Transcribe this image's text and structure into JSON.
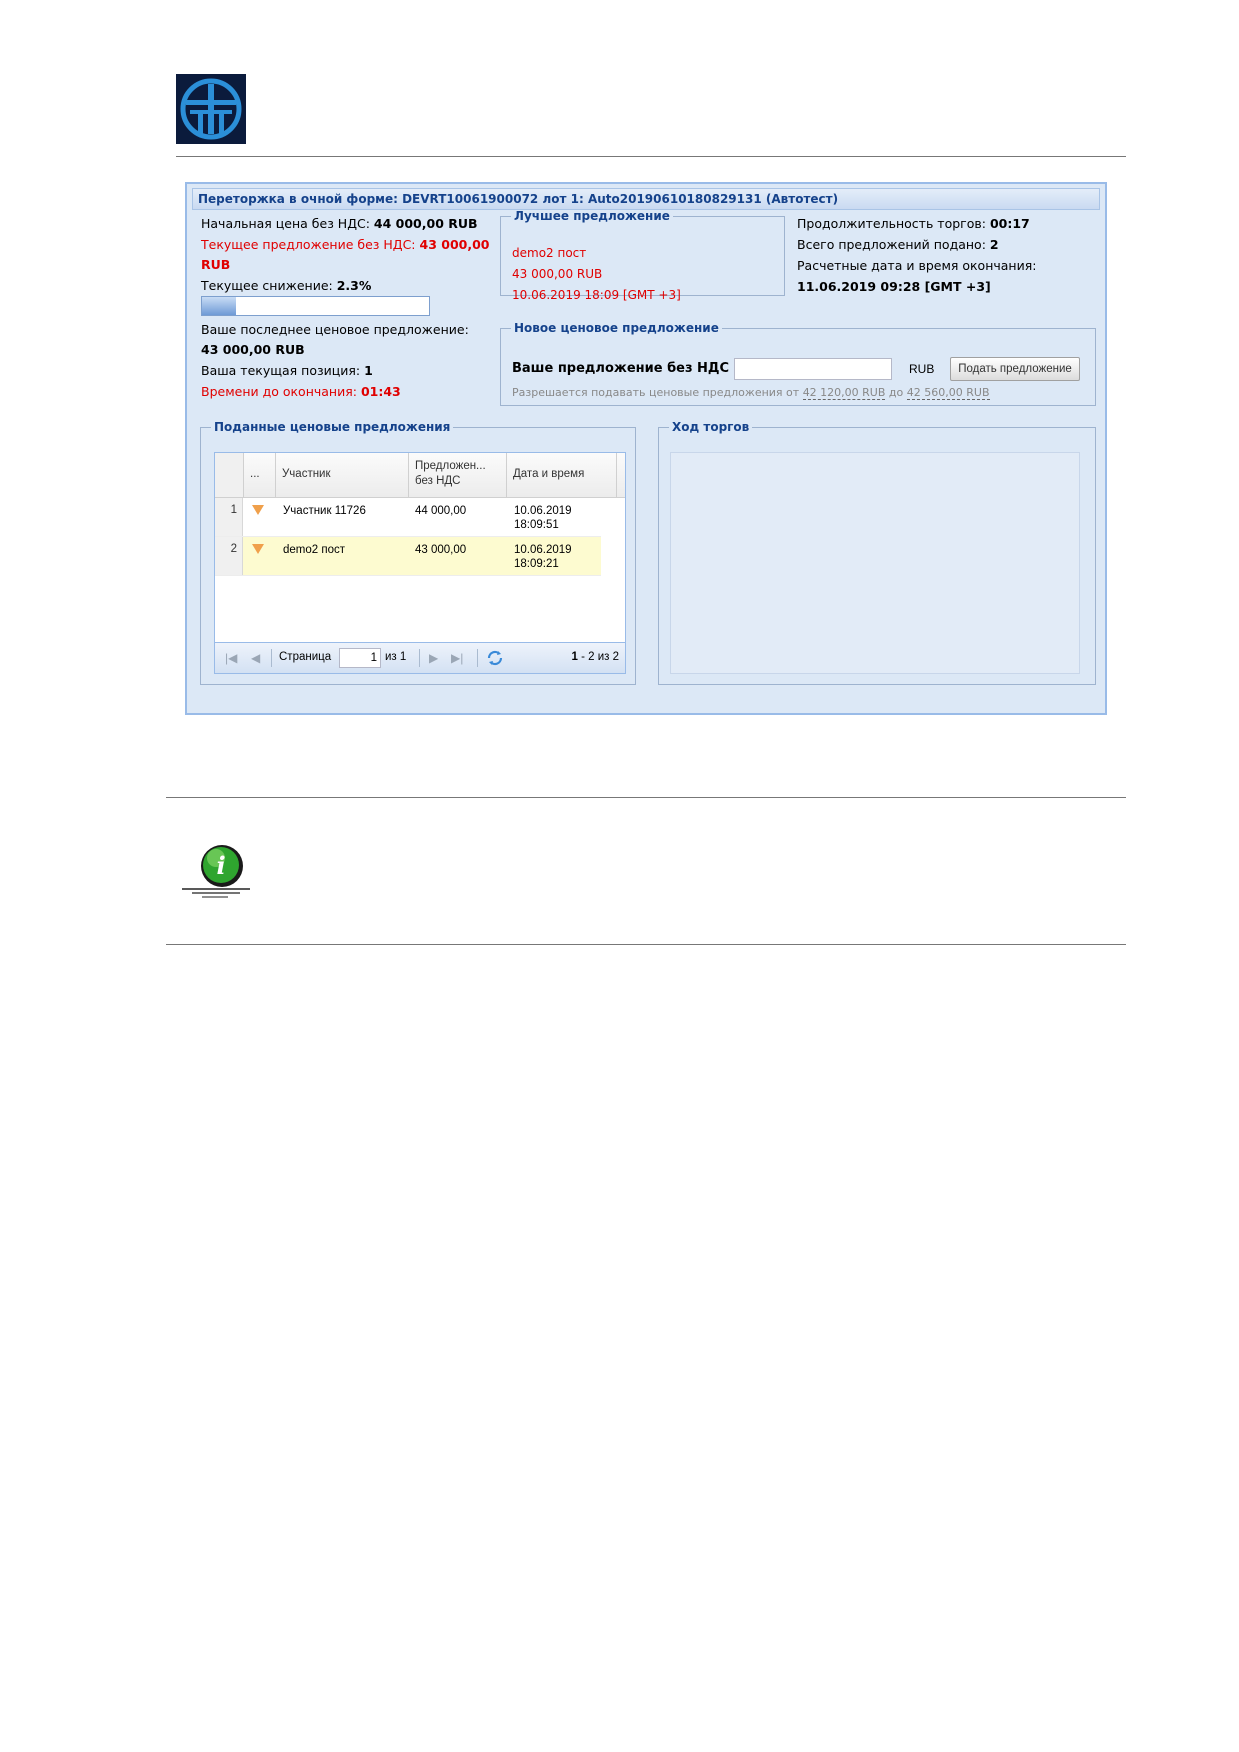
{
  "window": {
    "title": "Переторжка в очной форме: DEVRT10061900072 лот 1: Auto20190610180829131 (Автотест)"
  },
  "left_info": {
    "start_price_label": "Начальная цена без НДС:",
    "start_price_value": "44 000,00 RUB",
    "current_offer_label": "Текущее предложение без НДС:",
    "current_offer_value": "43 000,00",
    "current_offer_currency": "RUB",
    "current_decrease_label": "Текущее снижение:",
    "current_decrease_value": "2.3%",
    "decrease_progress_fraction": 0.15,
    "last_offer_label": "Ваше последнее ценовое предложение:",
    "last_offer_value": "43 000,00 RUB",
    "position_label": "Ваша текущая позиция:",
    "position_value": "1",
    "time_left_label": "Времени до окончания:",
    "time_left_value": "01:43"
  },
  "best_offer": {
    "legend": "Лучшее предложение",
    "participant": "demo2 пост",
    "amount": "43 000,00 RUB",
    "datetime": "10.06.2019 18:09 [GMT +3]"
  },
  "right_info": {
    "duration_label": "Продолжительность торгов:",
    "duration_value": "00:17",
    "total_offers_label": "Всего предложений подано:",
    "total_offers_value": "2",
    "end_label": "Расчетные дата и время окончания:",
    "end_value": "11.06.2019 09:28 [GMT +3]"
  },
  "new_offer": {
    "legend": "Новое ценовое предложение",
    "label": "Ваше предложение без НДС",
    "input_value": "",
    "currency": "RUB",
    "submit_label": "Подать предложение",
    "hint_prefix": "Разрешается подавать ценовые предложения от",
    "hint_from": "42 120,00 RUB",
    "hint_mid": "до",
    "hint_to": "42 560,00 RUB"
  },
  "submitted": {
    "legend": "Поданные ценовые предложения",
    "columns": [
      "...",
      "Участник",
      "Предложен... без НДС",
      "Дата и время"
    ],
    "rows": [
      {
        "num": "1",
        "participant": "Участник 11726",
        "amount": "44 000,00",
        "date": "10.06.2019",
        "time": "18:09:51"
      },
      {
        "num": "2",
        "participant": "demo2 пост",
        "amount": "43 000,00",
        "date": "10.06.2019",
        "time": "18:09:21"
      }
    ],
    "pager": {
      "page_label": "Страница",
      "page_value": "1",
      "of_label": "из 1",
      "summary_bold": "1",
      "summary_rest": " - 2 из 2"
    }
  },
  "progress_panel": {
    "legend": "Ход торгов"
  },
  "colors": {
    "accent_text": "#15428b",
    "highlight_row": "#fdfbd0",
    "alert_red": "#e00000",
    "panel_bg": "#dce8f6"
  }
}
